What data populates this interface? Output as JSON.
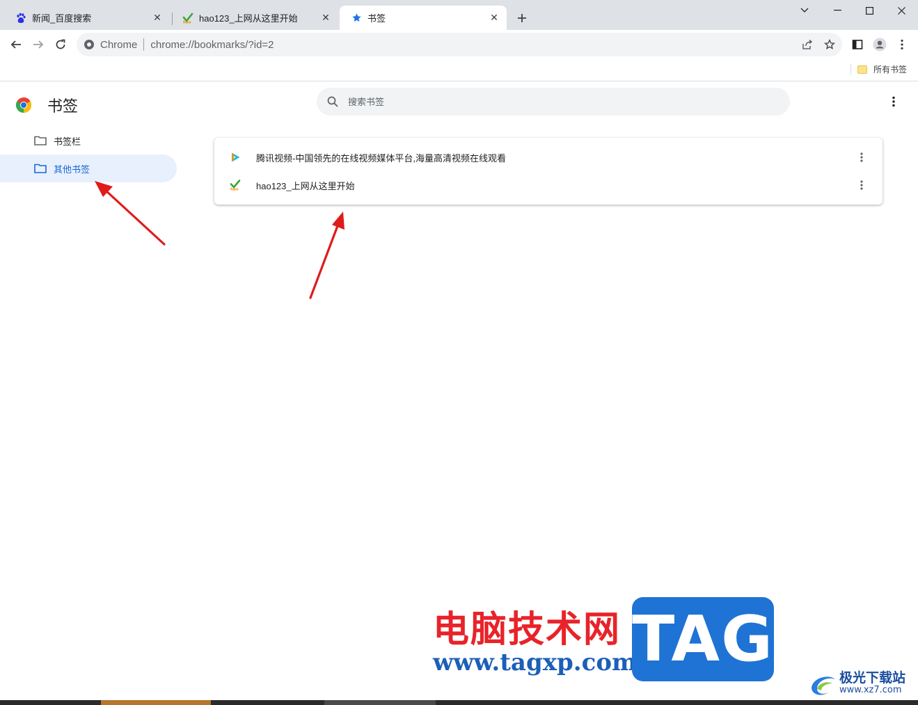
{
  "tabs": [
    {
      "title": "新闻_百度搜索",
      "icon": "baidu-paw-icon"
    },
    {
      "title": "hao123_上网从这里开始",
      "icon": "hao123-icon"
    },
    {
      "title": "书签",
      "icon": "star-icon",
      "active": true
    }
  ],
  "omnibox": {
    "chip": "Chrome",
    "url": "chrome://bookmarks/?id=2"
  },
  "bookmarks_bar": {
    "all_bookmarks": "所有书签"
  },
  "page": {
    "title": "书签",
    "search_placeholder": "搜索书签"
  },
  "sidebar": {
    "items": [
      {
        "label": "书签栏",
        "selected": false
      },
      {
        "label": "其他书签",
        "selected": true
      }
    ]
  },
  "bookmarks": [
    {
      "title": "腾讯视频-中国领先的在线视频媒体平台,海量高清视频在线观看",
      "icon": "tencent-video-icon"
    },
    {
      "title": "hao123_上网从这里开始",
      "icon": "hao123-icon"
    }
  ],
  "watermark": {
    "site_name": "电脑技术网",
    "site_url": "www.tagxp.com",
    "tag": "TAG",
    "brand_cn": "极光下载站",
    "brand_url": "www.xz7.com"
  },
  "colors": {
    "accent": "#1967d2",
    "selected_bg": "#e8f0fe",
    "arrow": "#e01b1b",
    "tabstrip": "#dee1e6"
  }
}
